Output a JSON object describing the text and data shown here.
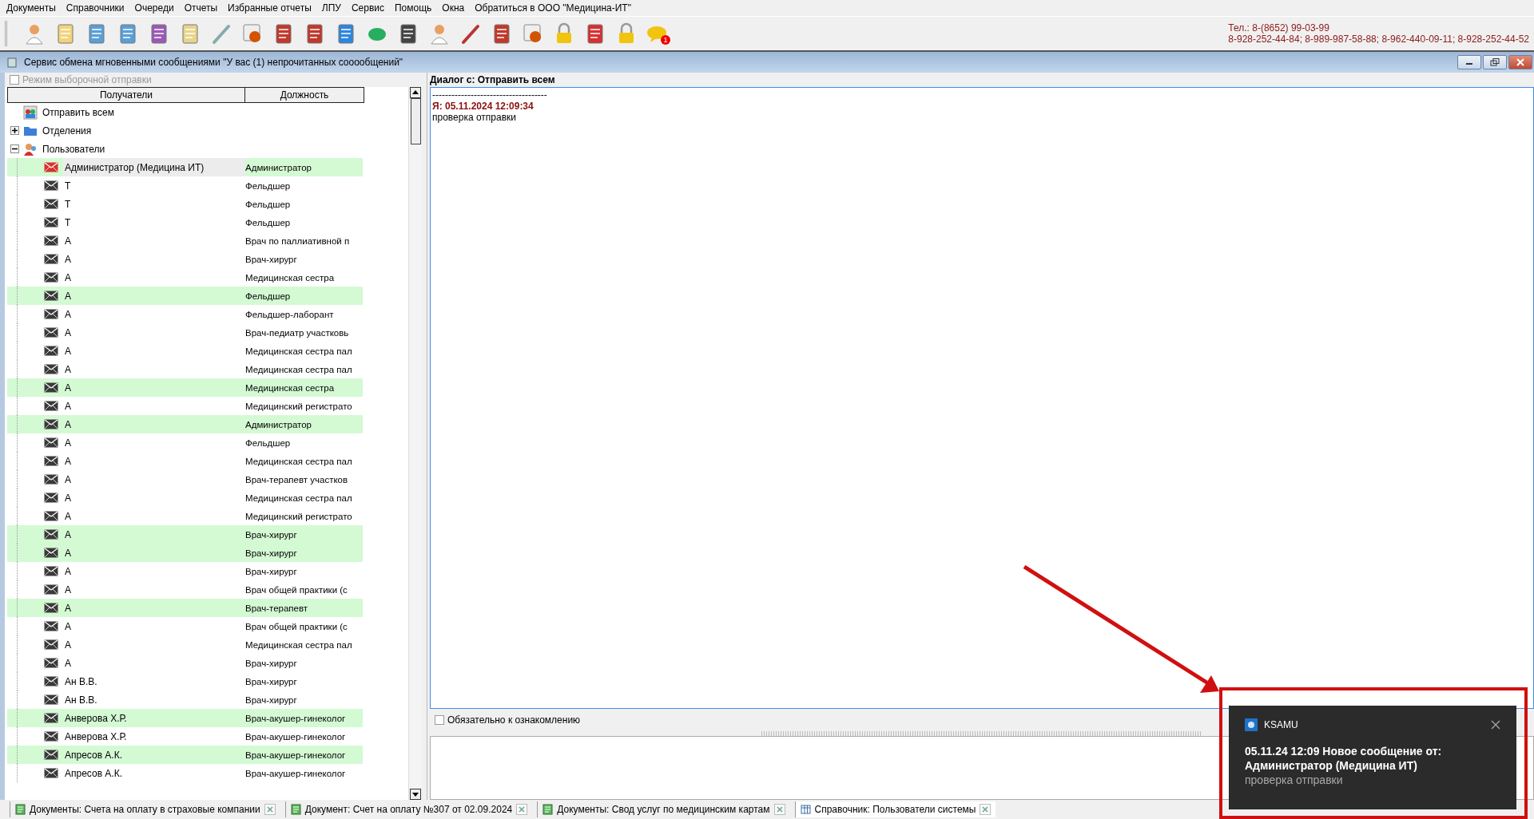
{
  "menu": [
    "Документы",
    "Справочники",
    "Очереди",
    "Отчеты",
    "Избранные отчеты",
    "ЛПУ",
    "Сервис",
    "Помощь",
    "Окна",
    "Обратиться в ООО \"Медицина-ИТ\""
  ],
  "toolbar": {
    "badge": "1"
  },
  "contacts": [
    "Тел.: 8-(8652) 99-03-99",
    "8-928-252-44-84; 8-989-987-58-88; 8-962-440-09-11; 8-928-252-44-52"
  ],
  "window": {
    "title": "Сервис обмена мгновенными сообщениями \"У вас (1) непрочитанных сооообщений\""
  },
  "recipients": {
    "selective_mode": {
      "label": "Режим выборочной отправки",
      "checked": false,
      "disabled": true
    },
    "columns": [
      "Получатели",
      "Должность"
    ],
    "tree": [
      {
        "label": "Отправить всем",
        "kind": "broadcast"
      },
      {
        "label": "Отделения",
        "kind": "departments",
        "expanded": false
      },
      {
        "label": "Пользователи",
        "kind": "users",
        "expanded": true,
        "children": [
          {
            "name": "Администратор (Медицина ИТ)",
            "position": "Администратор",
            "unread": true,
            "highlighted": true,
            "selected": true
          },
          {
            "name": "Т",
            "position": "Фельдшер",
            "unread": false,
            "highlighted": false,
            "selected": false
          },
          {
            "name": "Т",
            "position": "Фельдшер",
            "unread": false,
            "highlighted": false,
            "selected": false
          },
          {
            "name": "Т",
            "position": "Фельдшер",
            "unread": false,
            "highlighted": false,
            "selected": false
          },
          {
            "name": "А",
            "position": "Врач по паллиативной п",
            "unread": false,
            "highlighted": false,
            "selected": false
          },
          {
            "name": "А",
            "position": "Врач-хирург",
            "unread": false,
            "highlighted": false,
            "selected": false
          },
          {
            "name": "А",
            "position": "Медицинская сестра",
            "unread": false,
            "highlighted": false,
            "selected": false
          },
          {
            "name": "А",
            "position": "Фельдшер",
            "unread": false,
            "highlighted": true,
            "selected": false
          },
          {
            "name": "А",
            "position": "Фельдшер-лаборант",
            "unread": false,
            "highlighted": false,
            "selected": false
          },
          {
            "name": "А",
            "position": "Врач-педиатр участковь",
            "unread": false,
            "highlighted": false,
            "selected": false
          },
          {
            "name": "А",
            "position": "Медицинская сестра пал",
            "unread": false,
            "highlighted": false,
            "selected": false
          },
          {
            "name": "А",
            "position": "Медицинская сестра пал",
            "unread": false,
            "highlighted": false,
            "selected": false
          },
          {
            "name": "А",
            "position": "Медицинская сестра",
            "unread": false,
            "highlighted": true,
            "selected": false
          },
          {
            "name": "А",
            "position": "Медицинский регистрато",
            "unread": false,
            "highlighted": false,
            "selected": false
          },
          {
            "name": "А",
            "position": "Администратор",
            "unread": false,
            "highlighted": true,
            "selected": false
          },
          {
            "name": "А",
            "position": "Фельдшер",
            "unread": false,
            "highlighted": false,
            "selected": false
          },
          {
            "name": "А",
            "position": "Медицинская сестра пал",
            "unread": false,
            "highlighted": false,
            "selected": false
          },
          {
            "name": "А",
            "position": "Врач-терапевт участков",
            "unread": false,
            "highlighted": false,
            "selected": false
          },
          {
            "name": "А",
            "position": "Медицинская сестра пал",
            "unread": false,
            "highlighted": false,
            "selected": false
          },
          {
            "name": "А",
            "position": "Медицинский регистрато",
            "unread": false,
            "highlighted": false,
            "selected": false
          },
          {
            "name": "А",
            "position": "Врач-хирург",
            "unread": false,
            "highlighted": true,
            "selected": false
          },
          {
            "name": "А",
            "position": "Врач-хирург",
            "unread": false,
            "highlighted": true,
            "selected": false
          },
          {
            "name": "А",
            "position": "Врач-хирург",
            "unread": false,
            "highlighted": false,
            "selected": false
          },
          {
            "name": "А",
            "position": "Врач общей практики (с",
            "unread": false,
            "highlighted": false,
            "selected": false
          },
          {
            "name": "А",
            "position": "Врач-терапевт",
            "unread": false,
            "highlighted": true,
            "selected": false
          },
          {
            "name": "А",
            "position": "Врач общей практики (с",
            "unread": false,
            "highlighted": false,
            "selected": false
          },
          {
            "name": "А",
            "position": "Медицинская сестра пал",
            "unread": false,
            "highlighted": false,
            "selected": false
          },
          {
            "name": "А",
            "position": "Врач-хирург",
            "unread": false,
            "highlighted": false,
            "selected": false
          },
          {
            "name": "Ан В.В.",
            "position": "Врач-хирург",
            "unread": false,
            "highlighted": false,
            "selected": false
          },
          {
            "name": "Ан В.В.",
            "position": "Врач-хирург",
            "unread": false,
            "highlighted": false,
            "selected": false
          },
          {
            "name": "Анверова Х.Р.",
            "position": "Врач-акушер-гинеколог",
            "unread": false,
            "highlighted": true,
            "selected": false
          },
          {
            "name": "Анверова Х.Р.",
            "position": "Врач-акушер-гинеколог",
            "unread": false,
            "highlighted": false,
            "selected": false
          },
          {
            "name": "Апресов А.К.",
            "position": "Врач-акушер-гинеколог",
            "unread": false,
            "highlighted": true,
            "selected": false
          },
          {
            "name": "Апресов А.К.",
            "position": "Врач-акушер-гинеколог",
            "unread": false,
            "highlighted": false,
            "selected": false
          }
        ]
      }
    ]
  },
  "dialog": {
    "header": "Диалог с:  Отправить всем",
    "separator": "------------------------------------",
    "messages": [
      {
        "author": "Я: 05.11.2024 12:09:34",
        "text": "проверка отправки"
      }
    ],
    "must_read": {
      "label": "Обязательно к ознакомлению",
      "checked": false
    }
  },
  "tabs": [
    {
      "label": "Документы: Счета на оплату в страховые компании",
      "kind": "document",
      "selected": false
    },
    {
      "label": "Документ: Счет на оплату №307 от 02.09.2024",
      "kind": "document",
      "selected": false
    },
    {
      "label": "Документы: Свод услуг по медицинским картам",
      "kind": "document",
      "selected": false
    },
    {
      "label": "Справочник: Пользователи системы",
      "kind": "table",
      "selected": true
    }
  ],
  "notification": {
    "app": "KSAMU",
    "title": "05.11.24 12:09 Новое сообщение от: Администратор (Медицина ИТ)",
    "body": "проверка отправки"
  }
}
